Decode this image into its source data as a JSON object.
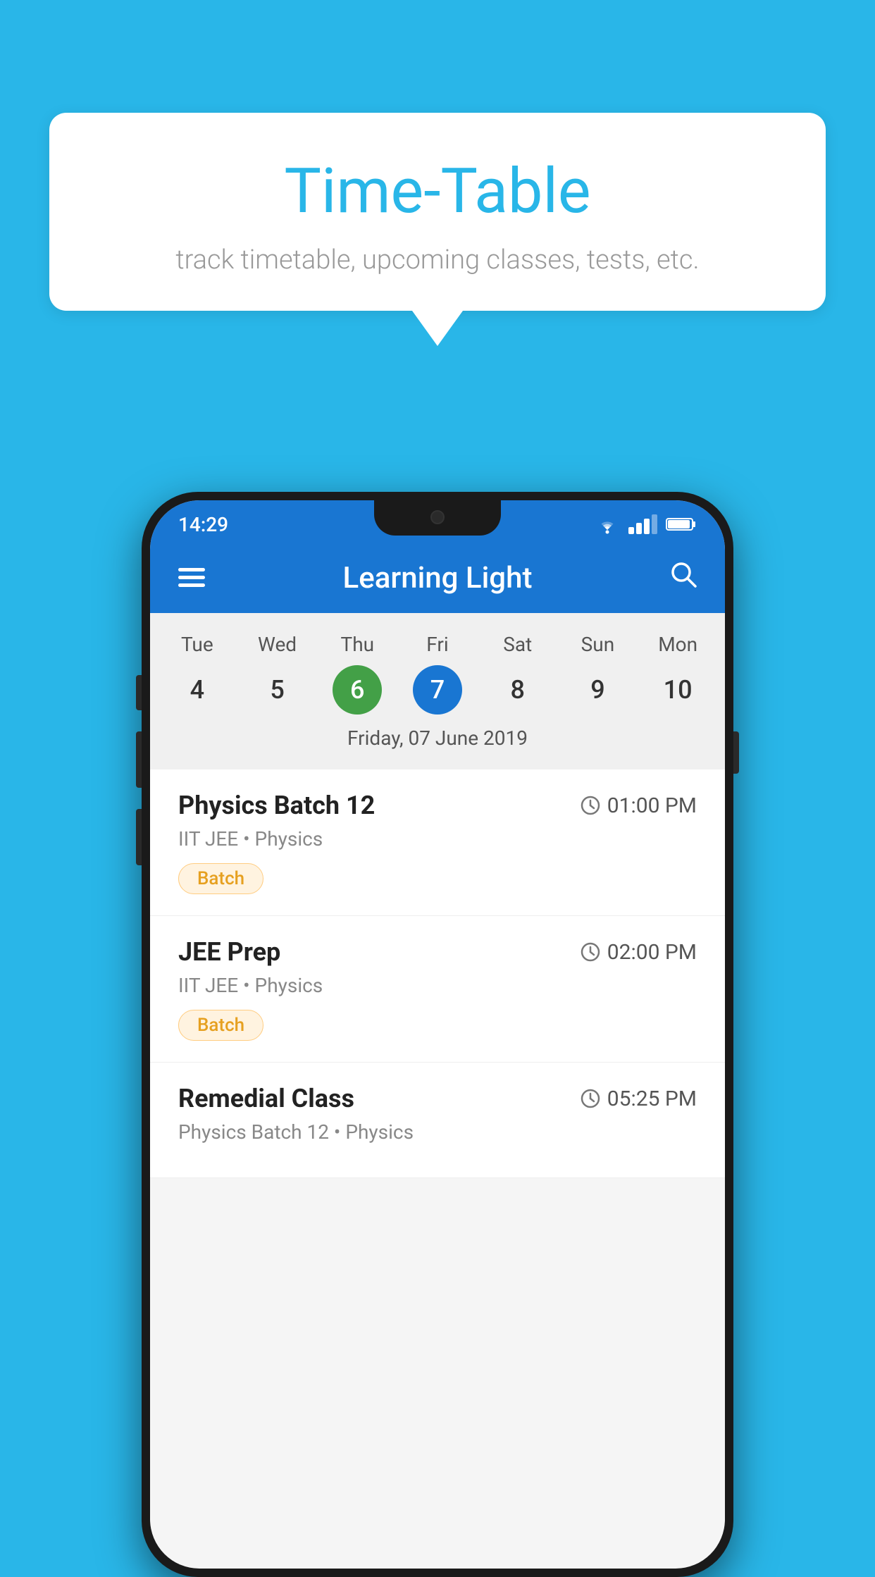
{
  "background_color": "#29b6e8",
  "speech_bubble": {
    "title": "Time-Table",
    "subtitle": "track timetable, upcoming classes, tests, etc."
  },
  "app": {
    "title": "Learning Light",
    "status_bar": {
      "time": "14:29"
    },
    "calendar": {
      "days": [
        "Tue",
        "Wed",
        "Thu",
        "Fri",
        "Sat",
        "Sun",
        "Mon"
      ],
      "dates": [
        "4",
        "5",
        "6",
        "7",
        "8",
        "9",
        "10"
      ],
      "today_index": 2,
      "selected_index": 3,
      "selected_date_label": "Friday, 07 June 2019"
    },
    "schedule": [
      {
        "title": "Physics Batch 12",
        "time": "01:00 PM",
        "subtitle": "IIT JEE • Physics",
        "badge": "Batch"
      },
      {
        "title": "JEE Prep",
        "time": "02:00 PM",
        "subtitle": "IIT JEE • Physics",
        "badge": "Batch"
      },
      {
        "title": "Remedial Class",
        "time": "05:25 PM",
        "subtitle": "Physics Batch 12 • Physics",
        "badge": null
      }
    ]
  }
}
